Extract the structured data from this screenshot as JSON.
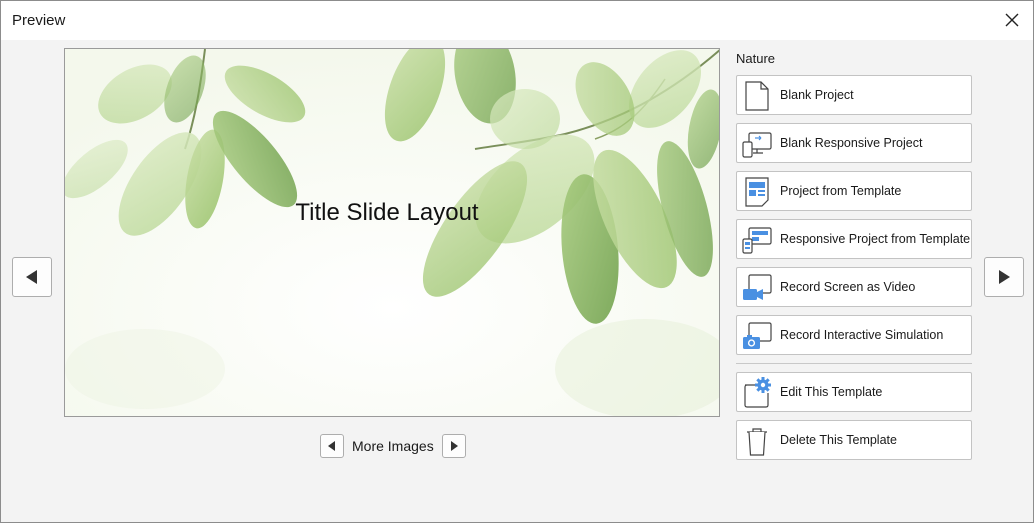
{
  "window": {
    "title": "Preview"
  },
  "preview": {
    "slide_title": "Title Slide Layout"
  },
  "more_images": {
    "label": "More Images"
  },
  "category": "Nature",
  "actions": [
    {
      "label": "Blank Project",
      "icon": "blank-project-icon"
    },
    {
      "label": "Blank Responsive Project",
      "icon": "responsive-project-icon"
    },
    {
      "label": "Project from Template",
      "icon": "template-project-icon"
    },
    {
      "label": "Responsive Project from Template",
      "icon": "responsive-template-icon"
    },
    {
      "label": "Record Screen as Video",
      "icon": "video-camera-icon"
    },
    {
      "label": "Record Interactive Simulation",
      "icon": "camera-icon"
    },
    {
      "label": "Edit This Template",
      "icon": "gear-icon"
    },
    {
      "label": "Delete This Template",
      "icon": "trash-icon"
    }
  ],
  "colors": {
    "accent": "#4a90e2",
    "border": "#c3c3c3",
    "background": "#f3f3f3"
  }
}
